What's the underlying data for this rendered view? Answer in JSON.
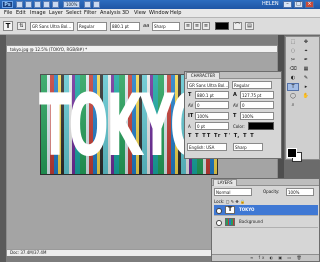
{
  "titlebar": {
    "app_logo": "Ps",
    "zoom": "100%",
    "user": "HELEN",
    "buttons": [
      "–",
      "□",
      "×"
    ]
  },
  "menu": [
    "File",
    "Edit",
    "Image",
    "Layer",
    "Select",
    "Filter",
    "Analysis",
    "3D",
    "View",
    "Window",
    "Help"
  ],
  "options_bar": {
    "tool_icon": "T",
    "font_family": "GR Sans Ultra Bol...",
    "font_style": "Regular",
    "font_size": "880.1 pt",
    "anti_alias_label": "aa",
    "anti_alias": "Sharp"
  },
  "document": {
    "tab_title": "tokyo.jpg @ 12.5% (TOKYO, RGB/8#) *",
    "status": "Doc: 37.4M/37.4M",
    "overlay_text": "TOKYO"
  },
  "character_panel": {
    "tabs": [
      "CHARACTER"
    ],
    "font_family": "GR Sans Ultra Bol...",
    "font_style": "Regular",
    "size": "880.1 pt",
    "leading": "127.75 pt",
    "kerning": "0",
    "tracking": "0",
    "vscale": "100%",
    "hscale": "100%",
    "baseline": "0 pt",
    "color_label": "Color:",
    "language": "English: USA",
    "anti_alias": "Sharp"
  },
  "layers_panel": {
    "tabs": [
      "LAYERS"
    ],
    "blend_mode": "Normal",
    "opacity_label": "Opacity:",
    "opacity": "100%",
    "layers": [
      {
        "name": "TOKYO",
        "selected": true,
        "thumb": "T"
      },
      {
        "name": "Background",
        "selected": false,
        "thumb": ""
      }
    ]
  },
  "tools": [
    "⬚",
    "✥",
    "◌",
    "⌖",
    "✂",
    "✒",
    "⌫",
    "▦",
    "◐",
    "✎",
    "T",
    "▸",
    "◯",
    "✋",
    "⌕"
  ],
  "colors": {
    "title_blue": "#1f56a5",
    "selected_layer": "#3f78d4"
  }
}
